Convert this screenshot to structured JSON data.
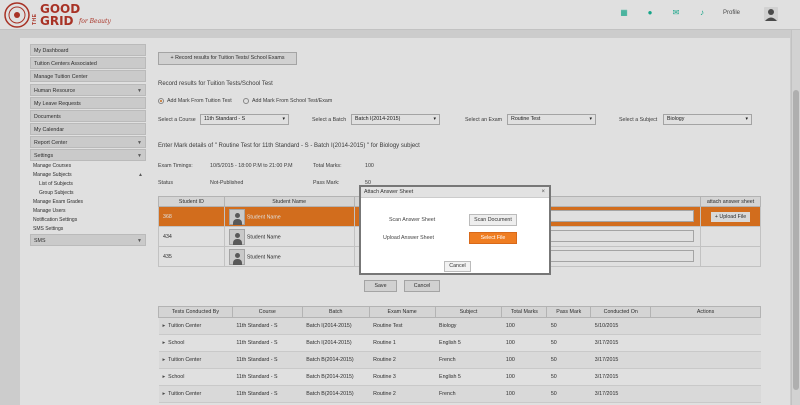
{
  "logo": {
    "the": "THE",
    "good": "GOOD",
    "grid": "GRID",
    "tag": "for Beauty"
  },
  "topbar": {
    "icons": [
      "grid-icon",
      "users-icon",
      "mail-icon",
      "bell-icon"
    ],
    "profile": "Profile"
  },
  "sidebar": {
    "items": [
      {
        "label": "My Dashboard"
      },
      {
        "label": "Tuition Centers Associated"
      },
      {
        "label": "Manage Tuition Center"
      },
      {
        "label": "Human Resource",
        "arrow": "▼"
      },
      {
        "label": "My Leave Requests"
      },
      {
        "label": "Documents"
      },
      {
        "label": "My Calendar"
      },
      {
        "label": "Report Center",
        "arrow": "▼"
      },
      {
        "label": "Settings",
        "arrow": "▼"
      }
    ],
    "sub": [
      {
        "label": "Manage Courses"
      },
      {
        "label": "Manage Subjects",
        "arrow": "▲"
      },
      {
        "label": "List of Subjects",
        "l2": true
      },
      {
        "label": "Group Subjects",
        "l2": true
      },
      {
        "label": "Manage Exam Grades"
      },
      {
        "label": "Manage Users"
      },
      {
        "label": "Notification Settings"
      },
      {
        "label": "SMS Settings"
      }
    ],
    "last": {
      "label": "SMS",
      "arrow": "▼"
    }
  },
  "main": {
    "record_btn": "Record results for Tuition Tests/ School Exams",
    "record_heading": "Record results for Tuition Tests/School Test",
    "radio1": "Add Mark From Tuition Test",
    "radio2": "Add Mark From School Test/Exam",
    "course_label": "Select a Course",
    "course_value": "11th Standard - S",
    "batch_label": "Select a Batch",
    "batch_value": "Batch I(2014-2015)",
    "exam_label": "Select an Exam",
    "exam_value": "Routine Test",
    "subject_label": "Select a Subject",
    "subject_value": "Biology",
    "enter_heading": "Enter Mark details of \" Routine Test  for 11th Standard - S  - Batch I(2014-2015) \" for Biology subject",
    "exam_timings_label": "Exam Timings:",
    "exam_timings": "10/5/2015 - 18:00 P.M to 21:00 P.M",
    "total_marks_label": "Total Marks:",
    "total_marks": "100",
    "status_label": "Status",
    "status": "Not-Published",
    "pass_mark_label": "Pass Mark:",
    "pass_mark": "50"
  },
  "student_table": {
    "headers": [
      "Student ID",
      "Student Name",
      "Remarks",
      "attach answer sheet"
    ],
    "rows": [
      {
        "id": "368",
        "name": "Student Name"
      },
      {
        "id": "434",
        "name": "Student Name"
      },
      {
        "id": "435",
        "name": "Student Name"
      }
    ],
    "upload_label": "+ Upload File"
  },
  "save_label": "Save",
  "cancel_label": "Cancel",
  "tests_table": {
    "headers": [
      "Tests Conducted By",
      "Course",
      "Batch",
      "Exam Name",
      "Subject",
      "Total Marks",
      "Pass Mark",
      "Conducted On",
      "Actions"
    ],
    "rows": [
      [
        "Tuition Center",
        "11th Standard - S",
        "Batch I(2014-2015)",
        "Routine Test",
        "Biology",
        "100",
        "50",
        "5/10/2015"
      ],
      [
        "School",
        "11th Standard - S",
        "Batch I(2014-2015)",
        "Routine 1",
        "English 5",
        "100",
        "50",
        "3/17/2015"
      ],
      [
        "Tuition Center",
        "11th Standard - S",
        "Batch B(2014-2015)",
        "Routine 2",
        "French",
        "100",
        "50",
        "3/17/2015"
      ],
      [
        "School",
        "11th Standard - S",
        "Batch B(2014-2015)",
        "Routine 3",
        "English 5",
        "100",
        "50",
        "3/17/2015"
      ],
      [
        "Tuition Center",
        "11th Standard - S",
        "Batch B(2014-2015)",
        "Routine 2",
        "French",
        "100",
        "50",
        "3/17/2015"
      ]
    ]
  },
  "modal": {
    "title": "Attach Answer Sheet",
    "close": "×",
    "scan_label": "Scan Answer Sheet",
    "scan_btn": "Scan Document",
    "upload_label": "Upload Answer Sheet",
    "upload_btn": "Select File",
    "cancel": "Cancel"
  },
  "colors": {
    "accent": "#ef7d22",
    "brand": "#c0392b",
    "icons": "#1abc9c"
  }
}
